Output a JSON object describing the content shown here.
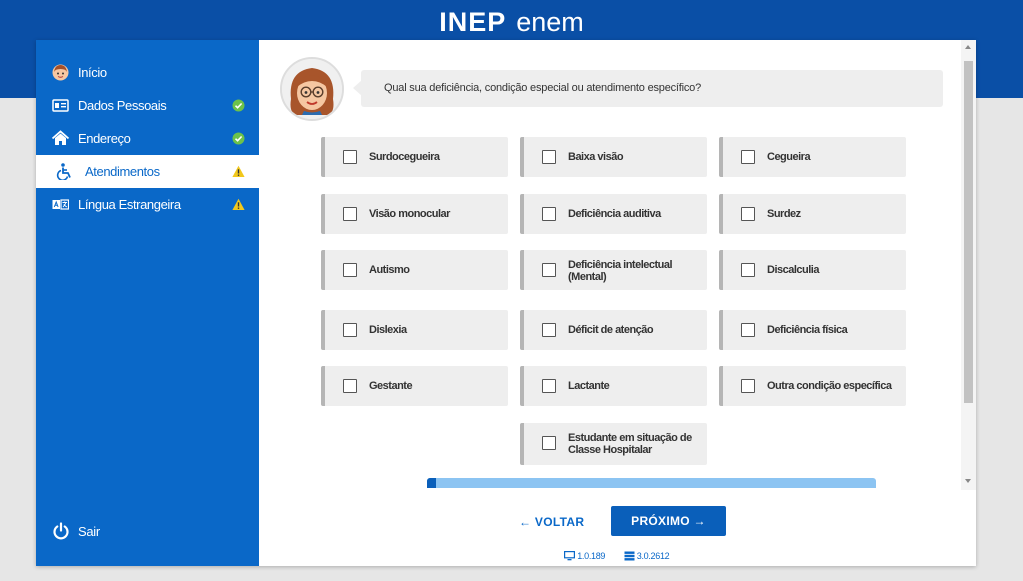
{
  "header": {
    "logo_inep": "INEP",
    "logo_enem": "enem"
  },
  "sidebar": {
    "items": [
      {
        "label": "Início",
        "icon": "user-avatar-icon",
        "status": "none"
      },
      {
        "label": "Dados Pessoais",
        "icon": "id-card-icon",
        "status": "done"
      },
      {
        "label": "Endereço",
        "icon": "home-icon",
        "status": "done"
      },
      {
        "label": "Atendimentos",
        "icon": "wheelchair-icon",
        "status": "warning",
        "active": true
      },
      {
        "label": "Língua Estrangeira",
        "icon": "translate-icon",
        "status": "warning"
      }
    ],
    "logout_label": "Sair"
  },
  "question": {
    "text": "Qual sua deficiência, condição especial ou atendimento específico?"
  },
  "options": [
    {
      "label": "Surdocegueira",
      "checked": false
    },
    {
      "label": "Baixa visão",
      "checked": false
    },
    {
      "label": "Cegueira",
      "checked": false
    },
    {
      "label": "Visão monocular",
      "checked": false
    },
    {
      "label": "Deficiência auditiva",
      "checked": false
    },
    {
      "label": "Surdez",
      "checked": false
    },
    {
      "label": "Autismo",
      "checked": false
    },
    {
      "label": "Deficiência intelectual (Mental)",
      "checked": false
    },
    {
      "label": "Discalculia",
      "checked": false
    },
    {
      "label": "Dislexia",
      "checked": false
    },
    {
      "label": "Déficit de atenção",
      "checked": false
    },
    {
      "label": "Deficiência física",
      "checked": false
    },
    {
      "label": "Gestante",
      "checked": false
    },
    {
      "label": "Lactante",
      "checked": false
    },
    {
      "label": "Outra condição específica",
      "checked": false
    },
    {
      "label": "Estudante em situação de Classe Hospitalar",
      "checked": false
    }
  ],
  "progress": {
    "fraction": 0.02
  },
  "nav": {
    "back_label": "← VOLTAR",
    "next_label": "PRÓXIMO →"
  },
  "footer": {
    "app_version": "1.0.189",
    "db_version": "3.0.2612"
  },
  "colors": {
    "brand_blue": "#0a4fa6",
    "sidebar_blue": "#0a68c8",
    "success": "#6cc24a",
    "warning": "#f2c81c"
  }
}
